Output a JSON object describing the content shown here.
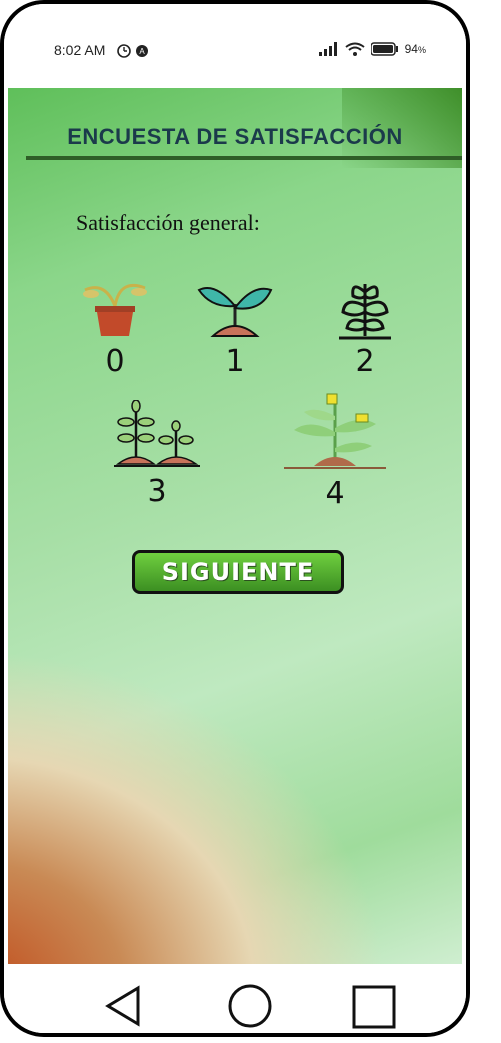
{
  "status": {
    "time": "8:02 AM",
    "battery": "94"
  },
  "survey": {
    "title": "ENCUESTA DE SATISFACCIÓN",
    "question": "Satisfacción general:",
    "options": [
      {
        "label": "0",
        "icon": "wilted-plant-pot-icon"
      },
      {
        "label": "1",
        "icon": "sprout-icon"
      },
      {
        "label": "2",
        "icon": "leafy-plant-icon"
      },
      {
        "label": "3",
        "icon": "two-plants-icon"
      },
      {
        "label": "4",
        "icon": "flowering-plant-icon"
      }
    ],
    "next_label": "SIGUIENTE"
  },
  "nav": {
    "back": "back-icon",
    "home": "home-icon",
    "recent": "recent-apps-icon"
  }
}
